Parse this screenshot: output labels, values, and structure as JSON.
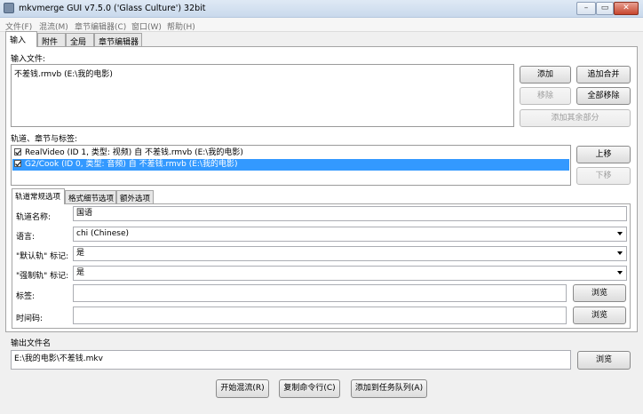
{
  "window": {
    "title": "mkvmerge GUI v7.5.0 ('Glass Culture') 32bit",
    "minimize_glyph": "–",
    "maximize_glyph": "▭",
    "close_glyph": "✕"
  },
  "menu": [
    "文件(F)",
    "混流(M)",
    "章节编辑器(C)",
    "窗口(W)",
    "帮助(H)"
  ],
  "tabs": [
    "输入",
    "附件",
    "全局",
    "章节编辑器"
  ],
  "input": {
    "label": "输入文件:",
    "files": [
      "不差钱.rmvb (E:\\我的电影)"
    ],
    "add": "添加",
    "append": "追加合并",
    "remove": "移除",
    "remove_all": "全部移除",
    "add_other": "添加其余部分"
  },
  "tracks": {
    "label": "轨道、章节与标签:",
    "items": [
      {
        "text": "RealVideo (ID 1, 类型: 视频) 自 不差钱.rmvb (E:\\我的电影)",
        "checked": true,
        "selected": false
      },
      {
        "text": "G2/Cook (ID 0, 类型: 音频) 自 不差钱.rmvb (E:\\我的电影)",
        "checked": true,
        "selected": true
      }
    ],
    "up": "上移",
    "down": "下移"
  },
  "subtabs": [
    "轨道常规选项",
    "格式细节选项",
    "额外选项"
  ],
  "options": {
    "track_name_label": "轨道名称:",
    "track_name_value": "国语",
    "language_label": "语言:",
    "language_value": "chi (Chinese)",
    "default_label": "\"默认轨\" 标记:",
    "default_value": "是",
    "forced_label": "\"强制轨\" 标记:",
    "forced_value": "是",
    "tags_label": "标签:",
    "tags_value": "",
    "timecodes_label": "时间码:",
    "timecodes_value": "",
    "browse": "浏览"
  },
  "output": {
    "label": "输出文件名",
    "value": "E:\\我的电影\\不差钱.mkv",
    "browse": "浏览"
  },
  "actions": {
    "start": "开始混流(R)",
    "copy": "复制命令行(C)",
    "queue": "添加到任务队列(A)"
  }
}
